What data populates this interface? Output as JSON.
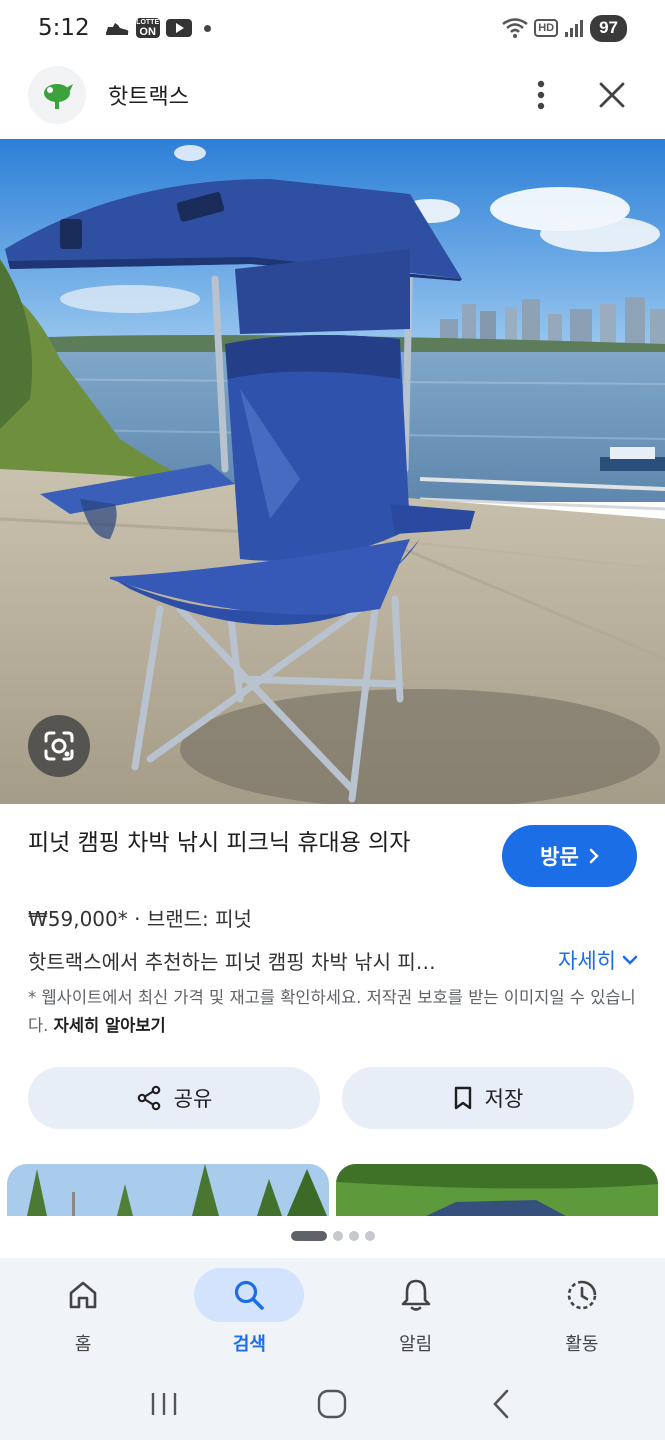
{
  "status_bar": {
    "time": "5:12",
    "lotte_line1": "LOTTE",
    "lotte_line2": "ON",
    "network": "HD",
    "battery": "97"
  },
  "app_bar": {
    "site_name": "핫트랙스"
  },
  "product": {
    "title": "피넛 캠핑 차박 낚시 피크닉 휴대용 의자",
    "price": "₩59,000*",
    "separator": " · ",
    "brand": "브랜드: 피넛",
    "description": "핫트랙스에서 추천하는 피넛 캠핑 차박 낚시 피…",
    "more_label": "자세히",
    "notice_text": "* 웹사이트에서 최신 가격 및 재고를 확인하세요. 저작권 보호를 받는 이미지일 수 있습니다. ",
    "notice_link": "자세히 알아보기"
  },
  "buttons": {
    "visit": "방문",
    "share": "공유",
    "save": "저장"
  },
  "pagination": {
    "total": 4,
    "current": 1
  },
  "bottom_nav": [
    {
      "label": "홈",
      "icon": "home-icon"
    },
    {
      "label": "검색",
      "icon": "search-icon",
      "active": true
    },
    {
      "label": "알림",
      "icon": "bell-icon"
    },
    {
      "label": "활동",
      "icon": "history-icon"
    }
  ],
  "colors": {
    "accent": "#1b6ee5",
    "chip_bg": "#e8eef8",
    "nav_bg": "#f0f4f9",
    "chair_blue": "#2f4fa3"
  }
}
